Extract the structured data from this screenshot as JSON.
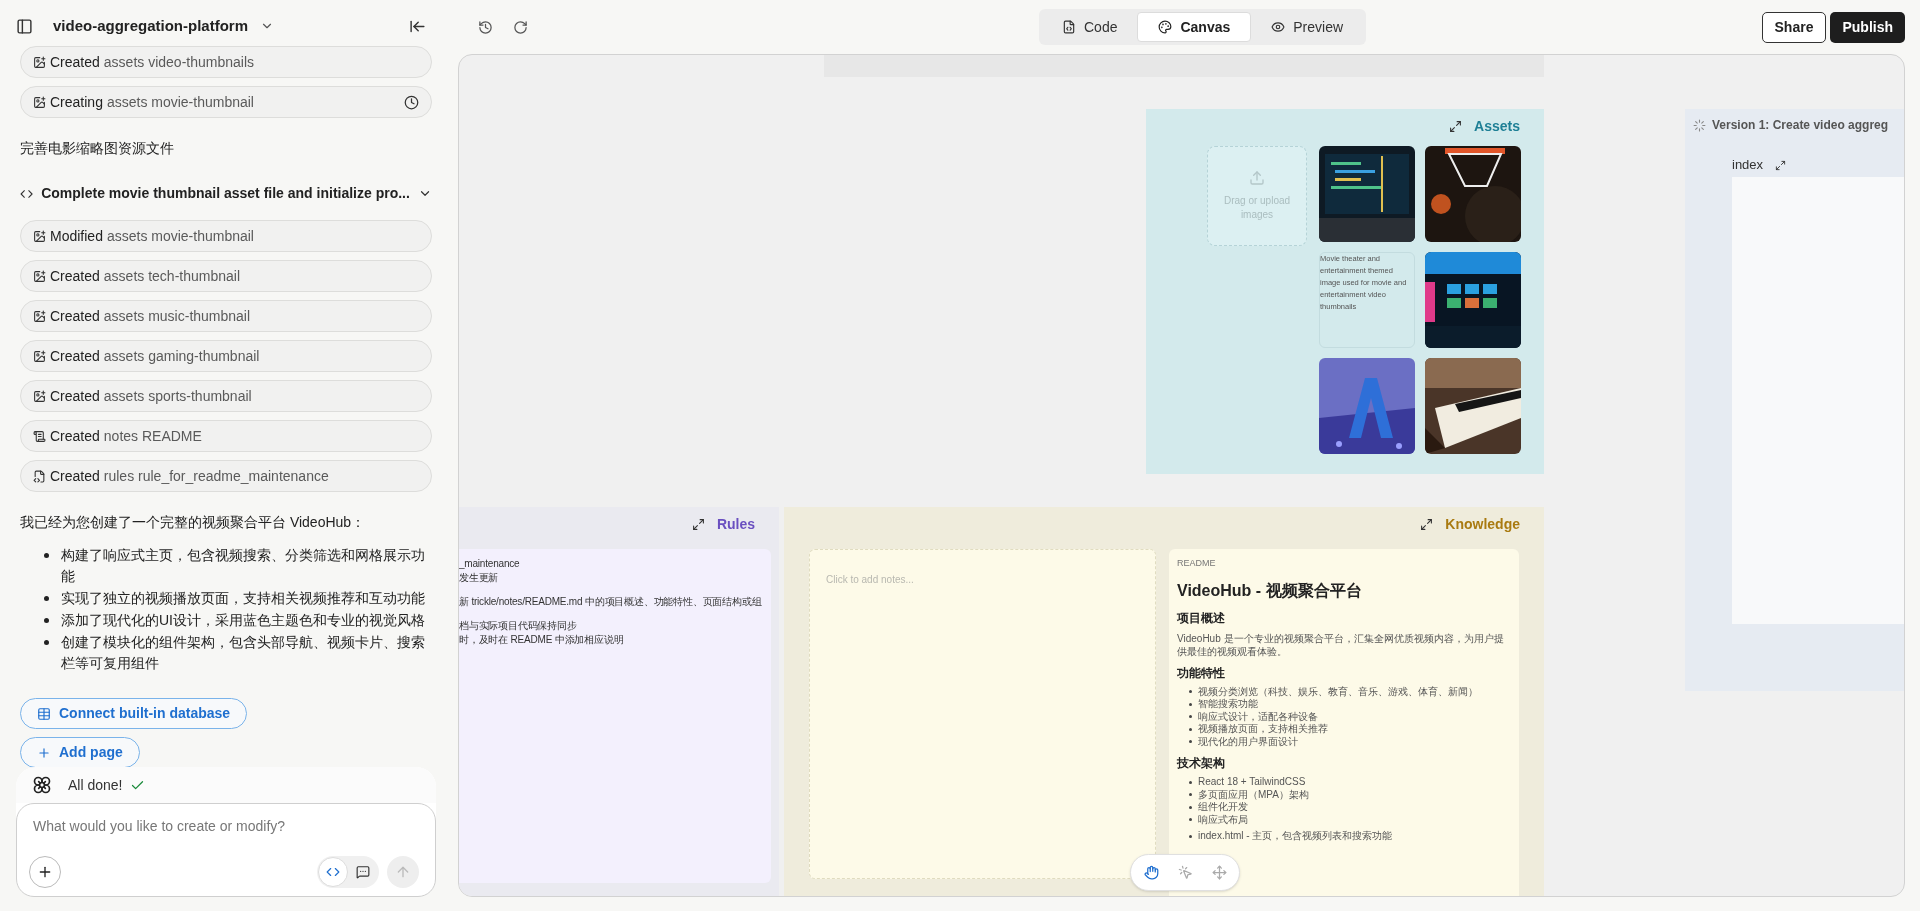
{
  "project": {
    "name": "video-aggregation-platform"
  },
  "chat": [
    {
      "kind": "asset_activity",
      "verb": "Created",
      "target": "assets video-thumbnails",
      "pending": false
    },
    {
      "kind": "asset_activity",
      "verb": "Creating",
      "target": "assets movie-thumbnail",
      "pending": true
    },
    {
      "kind": "message",
      "text": "完善电影缩略图资源文件"
    },
    {
      "kind": "group",
      "title": "Complete movie thumbnail asset file and initialize pro...",
      "expanded": true
    },
    {
      "kind": "asset_activity",
      "verb": "Modified",
      "target": "assets movie-thumbnail",
      "pending": false
    },
    {
      "kind": "asset_activity",
      "verb": "Created",
      "target": "assets tech-thumbnail",
      "pending": false
    },
    {
      "kind": "asset_activity",
      "verb": "Created",
      "target": "assets music-thumbnail",
      "pending": false
    },
    {
      "kind": "asset_activity",
      "verb": "Created",
      "target": "assets gaming-thumbnail",
      "pending": false
    },
    {
      "kind": "asset_activity",
      "verb": "Created",
      "target": "assets sports-thumbnail",
      "pending": false
    },
    {
      "kind": "notes_activity",
      "verb": "Created",
      "target": "notes README",
      "pending": false
    },
    {
      "kind": "rules_activity",
      "verb": "Created",
      "target": "rules rule_for_readme_maintenance",
      "pending": false
    },
    {
      "kind": "summary",
      "text": "我已经为您创建了一个完整的视频聚合平台 VideoHub：",
      "bullets": [
        "构建了响应式主页，包含视频搜索、分类筛选和网格展示功能",
        "实现了独立的视频播放页面，支持相关视频推荐和互动功能",
        "添加了现代化的UI设计，采用蓝色主题色和专业的视觉风格",
        "创建了模块化的组件架构，包含头部导航、视频卡片、搜索栏等可复用组件"
      ]
    }
  ],
  "actions": [
    {
      "kind": "database",
      "label": "Connect built-in database"
    },
    {
      "kind": "add",
      "label": "Add page"
    }
  ],
  "status": {
    "text": "All done!",
    "done": true
  },
  "composer": {
    "placeholder": "What would you like to create or modify?",
    "modes": [
      {
        "kind": "code",
        "selected": true
      },
      {
        "kind": "chat",
        "selected": false
      }
    ],
    "send_disabled": true
  },
  "toolbar": {
    "tabs": [
      {
        "kind": "code",
        "label": "Code",
        "selected": false
      },
      {
        "kind": "canvas",
        "label": "Canvas",
        "selected": true
      },
      {
        "kind": "preview",
        "label": "Preview",
        "selected": false
      }
    ],
    "share": "Share",
    "publish": "Publish"
  },
  "canvas": {
    "assets": {
      "title": "Assets",
      "upload": "Drag or upload images",
      "images": [
        {
          "kind": "picture"
        },
        {
          "kind": "picture"
        },
        {
          "kind": "broken",
          "alt": "Movie theater and entertainment themed image used for movie and entertainment video thumbnails"
        },
        {
          "kind": "picture"
        },
        {
          "kind": "picture"
        },
        {
          "kind": "picture"
        }
      ]
    },
    "version": {
      "title": "Version 1: Create video aggreg",
      "page": "index"
    },
    "rules": {
      "title": "Rules",
      "paragraphs": [
        [
          "_maintenance",
          "发生更新"
        ],
        [
          "新 trickle/notes/README.md 中的项目概述、功能特性、页面结构或组"
        ],
        [
          "档与实际项目代码保持同步",
          "时，及时在 README 中添加相应说明"
        ]
      ]
    },
    "knowledge": {
      "title": "Knowledge",
      "notes_placeholder": "Click to add notes...",
      "readme": {
        "label": "README",
        "title": "VideoHub - 视频聚合平台",
        "sections": [
          {
            "heading": "项目概述",
            "paragraph": "VideoHub 是一个专业的视频聚合平台，汇集全网优质视频内容，为用户提供最佳的视频观看体验。"
          },
          {
            "heading": "功能特性",
            "bullets": [
              "视频分类浏览（科技、娱乐、教育、音乐、游戏、体育、新闻）",
              "智能搜索功能",
              "响应式设计，适配各种设备",
              "视频播放页面，支持相关推荐",
              "现代化的用户界面设计"
            ]
          },
          {
            "heading": "技术架构",
            "bullets": [
              "React 18 + TailwindCSS",
              "多页面应用（MPA）架构",
              "组件化开发",
              "响应式布局"
            ]
          },
          {
            "bullets": [
              "index.html - 主页，包含视频列表和搜索功能"
            ]
          }
        ]
      }
    },
    "tools": [
      {
        "kind": "hand",
        "selected": true
      },
      {
        "kind": "select",
        "selected": false
      },
      {
        "kind": "move",
        "selected": false
      }
    ]
  }
}
